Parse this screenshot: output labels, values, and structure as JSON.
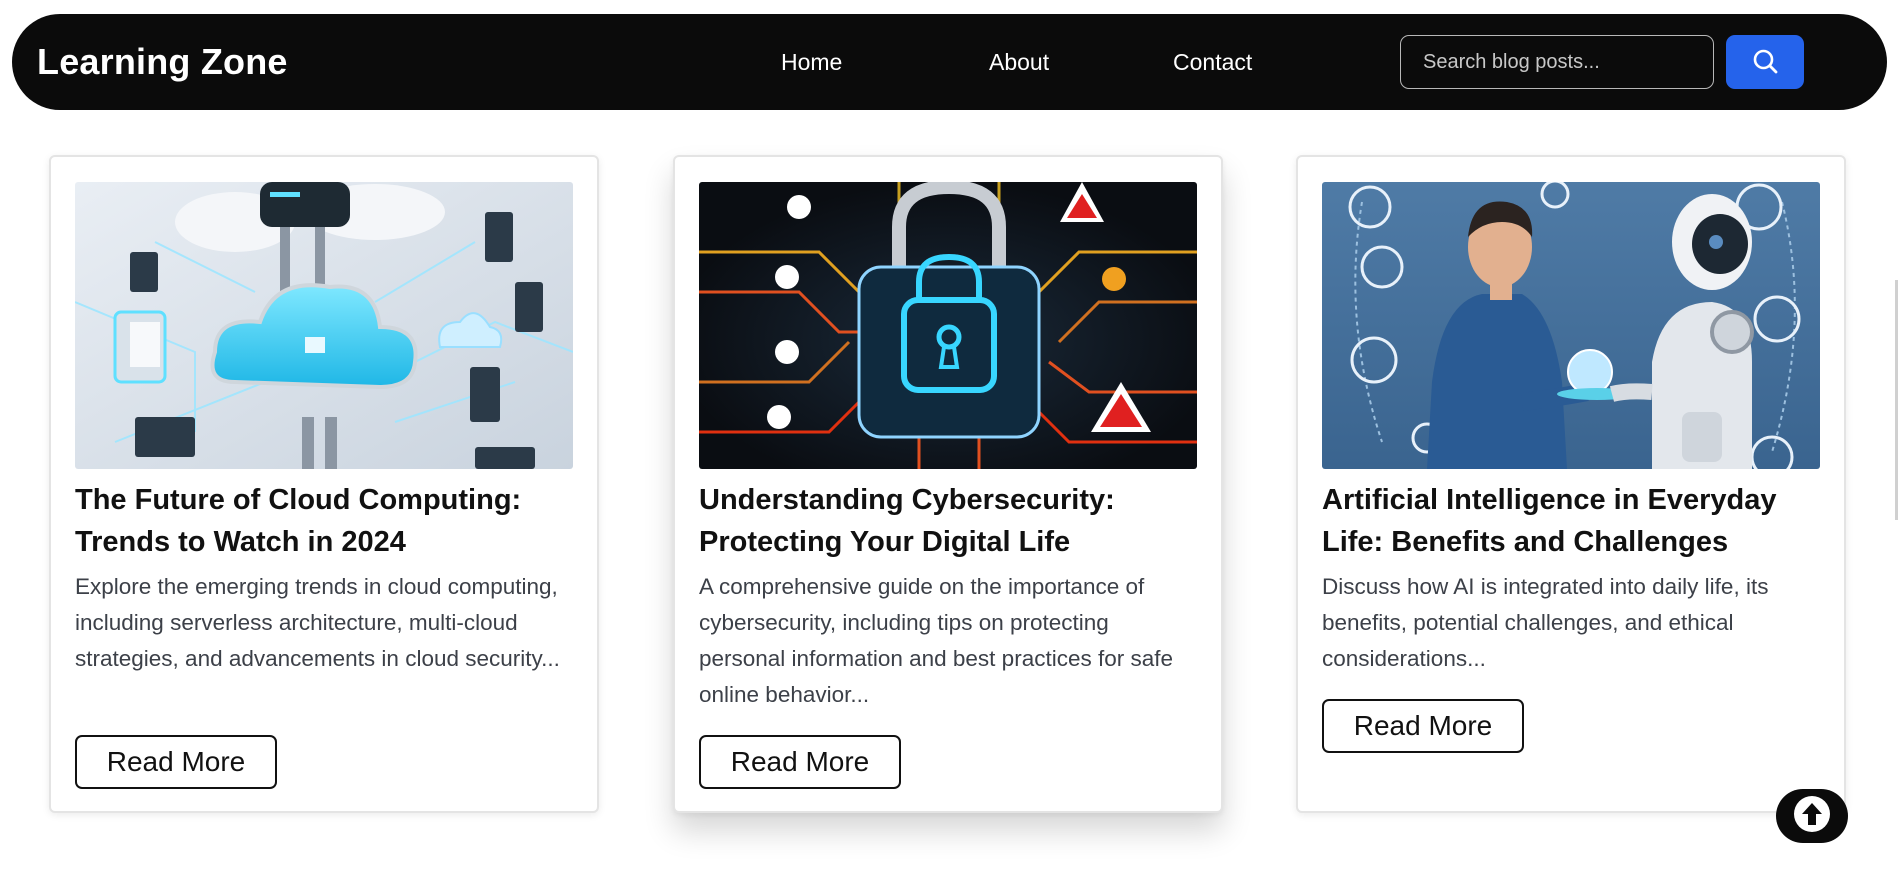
{
  "navbar": {
    "brand": "Learning Zone",
    "links": [
      "Home",
      "About",
      "Contact"
    ],
    "search": {
      "placeholder": "Search blog posts...",
      "value": "",
      "button_icon": "search-icon"
    }
  },
  "posts": [
    {
      "title": "The Future of Cloud Computing: Trends to Watch in 2024",
      "excerpt": "Explore the emerging trends in cloud computing, including serverless architecture, multi-cloud strategies, and advancements in cloud security...",
      "button": "Read More",
      "image": "cloud-computing-illustration"
    },
    {
      "title": "Understanding Cybersecurity: Protecting Your Digital Life",
      "excerpt": "A comprehensive guide on the importance of cybersecurity, including tips on protecting personal information and best practices for safe online behavior...",
      "button": "Read More",
      "image": "cybersecurity-padlock-illustration"
    },
    {
      "title": "Artificial Intelligence in Everyday Life: Benefits and Challenges",
      "excerpt": "Discuss how AI is integrated into daily life, its benefits, potential challenges, and ethical considerations...",
      "button": "Read More",
      "image": "human-and-robot-illustration"
    }
  ],
  "back_to_top": {
    "icon": "arrow-up-icon"
  },
  "colors": {
    "navbar_bg": "#0b0b0b",
    "search_button": "#2563eb",
    "text_primary": "#111111",
    "text_secondary": "#3c4048"
  }
}
